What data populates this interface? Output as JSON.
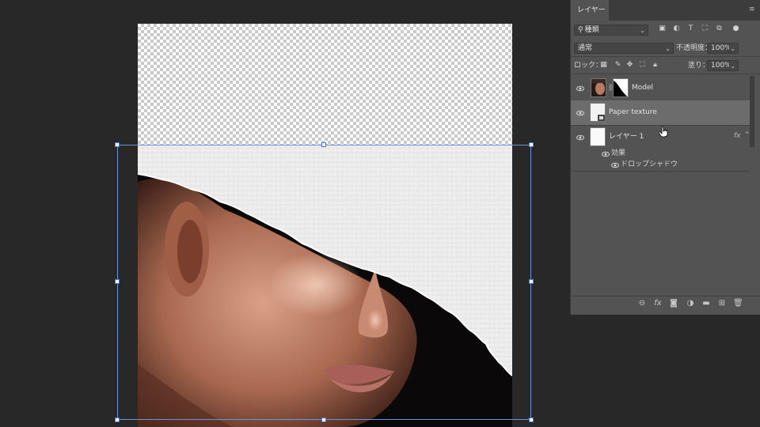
{
  "panel": {
    "tab_label": "レイヤー",
    "filter": {
      "value": "種類"
    },
    "blend_mode": {
      "value": "通常"
    },
    "opacity": {
      "label": "不透明度：",
      "value": "100%"
    },
    "lock_label": "ロック：",
    "fill": {
      "label": "塗り：",
      "value": "100%"
    },
    "layers": [
      {
        "name": "Model",
        "selected": false,
        "visible": true
      },
      {
        "name": "Paper texture",
        "selected": true,
        "visible": true
      },
      {
        "name": "レイヤー 1",
        "selected": false,
        "visible": true,
        "fx": "fx"
      }
    ],
    "effects_label": "効果",
    "effect_item": "ドロップシャドウ",
    "footer_icons": [
      "link-icon",
      "fx-icon",
      "mask-icon",
      "adjustment-icon",
      "group-folder-icon",
      "new-layer-icon",
      "trash-icon"
    ]
  },
  "colors": {
    "background": "#282828",
    "panel": "#535353",
    "selected_layer": "#6c6c6c",
    "transform_box": "#6c93d4"
  }
}
